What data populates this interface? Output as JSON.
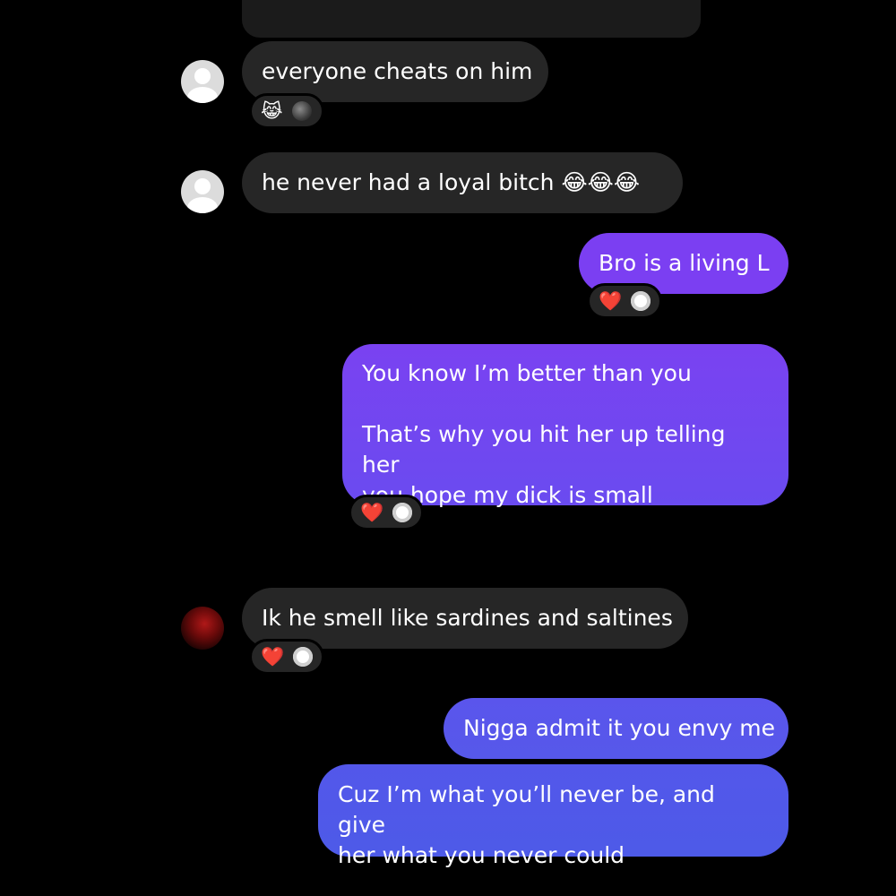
{
  "messages": [
    {
      "sender": "them",
      "text": "everyone cheats on him",
      "reactions": [
        "😹",
        "ghost-avatar"
      ]
    },
    {
      "sender": "them",
      "text": "he never had a loyal bitch 😂😂😂"
    },
    {
      "sender": "me",
      "text": "Bro is a living L",
      "reactions": [
        "❤️",
        "avatar"
      ]
    },
    {
      "sender": "me",
      "lines": [
        "You know I’m better than you",
        "That’s why you hit her up telling her",
        "you hope my dick is small"
      ],
      "reactions": [
        "❤️",
        "avatar"
      ]
    },
    {
      "sender": "them",
      "text": "Ik he smell like sardines and saltines",
      "reactions": [
        "❤️",
        "avatar"
      ]
    },
    {
      "sender": "me",
      "text": "Nigga admit it you envy me"
    },
    {
      "sender": "me",
      "lines": [
        "Cuz I’m what you’ll never be, and give",
        "her what you never could"
      ]
    }
  ],
  "colors": {
    "background": "#000000",
    "incoming_bubble": "#262626",
    "outgoing_top": "#7a3ff0",
    "outgoing_bottom": "#4f5ce8"
  }
}
